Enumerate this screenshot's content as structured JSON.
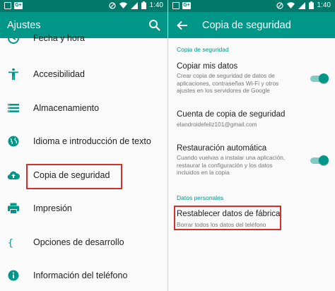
{
  "status_bar": {
    "time": "1:40",
    "g_badge": "G+"
  },
  "colors": {
    "accent": "#009688",
    "status": "#00796b",
    "highlight": "#d32f2f"
  },
  "left": {
    "title": "Ajustes",
    "items": [
      {
        "label": "Fecha y hora",
        "icon": "clock-icon"
      },
      {
        "label": "Accesibilidad",
        "icon": "accessibility-icon"
      },
      {
        "label": "Almacenamiento",
        "icon": "storage-icon"
      },
      {
        "label": "Idioma e introducción de texto",
        "icon": "globe-icon"
      },
      {
        "label": "Copia de seguridad",
        "icon": "cloud-upload-icon"
      },
      {
        "label": "Impresión",
        "icon": "printer-icon"
      },
      {
        "label": "Opciones de desarrollo",
        "icon": "braces-icon"
      },
      {
        "label": "Información del teléfono",
        "icon": "info-icon"
      }
    ]
  },
  "right": {
    "title": "Copia de seguridad",
    "section_backup": "Copia de seguridad",
    "copy_data": {
      "title": "Copiar mis datos",
      "summary": "Crear copia de seguridad de datos de aplicaciones, contraseñas Wi-Fi y otros ajustes en los servidores de Google",
      "enabled": true
    },
    "account": {
      "title": "Cuenta de copia de seguridad",
      "summary": "elandroidefeliz101@gmail.com"
    },
    "auto_restore": {
      "title": "Restauración automática",
      "summary": "Cuando vuelvas a instalar una aplicación, restaurar la configuración y los datos incluidos en la copia",
      "enabled": true
    },
    "section_personal": "Datos personales",
    "factory_reset": {
      "title": "Restablecer datos de fábrica",
      "summary": "Borrar todos los datos del teléfono"
    }
  }
}
